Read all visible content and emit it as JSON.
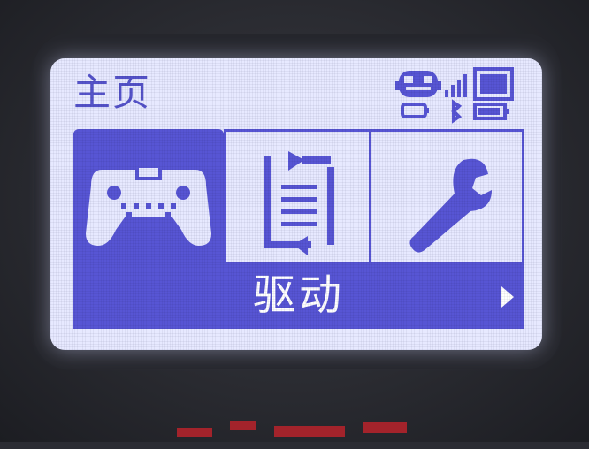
{
  "screen": {
    "title": "主页",
    "selected_label": "驱动"
  },
  "menu": {
    "items": [
      {
        "icon": "gamepad-icon",
        "selected": true
      },
      {
        "icon": "update-icon",
        "selected": false
      },
      {
        "icon": "wrench-icon",
        "selected": false
      }
    ]
  },
  "status": {
    "icons": [
      "robot-icon",
      "signal-strength-icon",
      "bluetooth-icon",
      "battery-icon"
    ]
  },
  "colors": {
    "lcd_background": "#e7e9ff",
    "accent": "#5755d4",
    "text_on_accent": "#ffffff"
  }
}
